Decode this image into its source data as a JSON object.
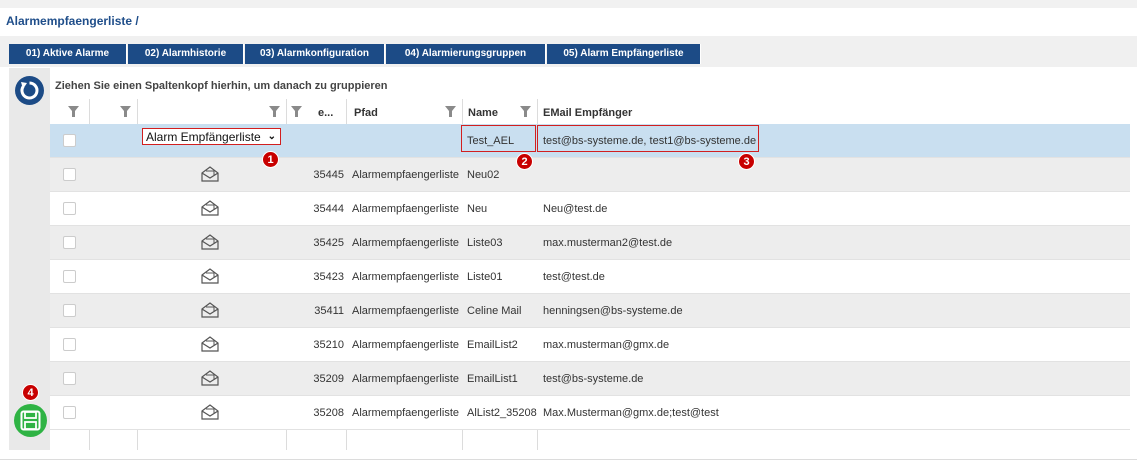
{
  "breadcrumb": "Alarmempfaengerliste /",
  "tabs": [
    {
      "label": "01) Aktive Alarme"
    },
    {
      "label": "02) Alarmhistorie"
    },
    {
      "label": "03) Alarmkonfiguration"
    },
    {
      "label": "04) Alarmierungsgruppen"
    },
    {
      "label": "05) Alarm Empfängerliste"
    }
  ],
  "group_hint": "Ziehen Sie einen Spaltenkopf hierhin, um danach zu gruppieren",
  "columns": {
    "id": "e...",
    "path": "Pfad",
    "name": "Name",
    "email": "EMail Empfänger"
  },
  "edit_row": {
    "type_select": "Alarm Empfängerliste",
    "name": "Test_AEL",
    "email": "test@bs-systeme.de, test1@bs-systeme.de"
  },
  "rows": [
    {
      "id": "35445",
      "path": "Alarmempfaengerliste",
      "name": "Neu02",
      "email": ""
    },
    {
      "id": "35444",
      "path": "Alarmempfaengerliste",
      "name": "Neu",
      "email": "Neu@test.de"
    },
    {
      "id": "35425",
      "path": "Alarmempfaengerliste",
      "name": "Liste03",
      "email": "max.musterman2@test.de"
    },
    {
      "id": "35423",
      "path": "Alarmempfaengerliste",
      "name": "Liste01",
      "email": "test@test.de"
    },
    {
      "id": "35411",
      "path": "Alarmempfaengerliste",
      "name": "Celine Mail",
      "email": "henningsen@bs-systeme.de"
    },
    {
      "id": "35210",
      "path": "Alarmempfaengerliste",
      "name": "EmailList2",
      "email": "max.musterman@gmx.de"
    },
    {
      "id": "35209",
      "path": "Alarmempfaengerliste",
      "name": "EmailList1",
      "email": "test@bs-systeme.de"
    },
    {
      "id": "35208",
      "path": "Alarmempfaengerliste",
      "name": "AlList2_35208",
      "email": "Max.Musterman@gmx.de;test@test"
    }
  ],
  "annotations": [
    "1",
    "2",
    "3",
    "4"
  ],
  "icons": {
    "refresh": "refresh-icon",
    "filter": "filter-icon",
    "mail": "envelope-icon",
    "save": "save-icon"
  },
  "colors": {
    "tab": "#1c4b86",
    "selected_row": "#c9dff0",
    "annotation": "#c80000",
    "save": "#2fb344"
  }
}
